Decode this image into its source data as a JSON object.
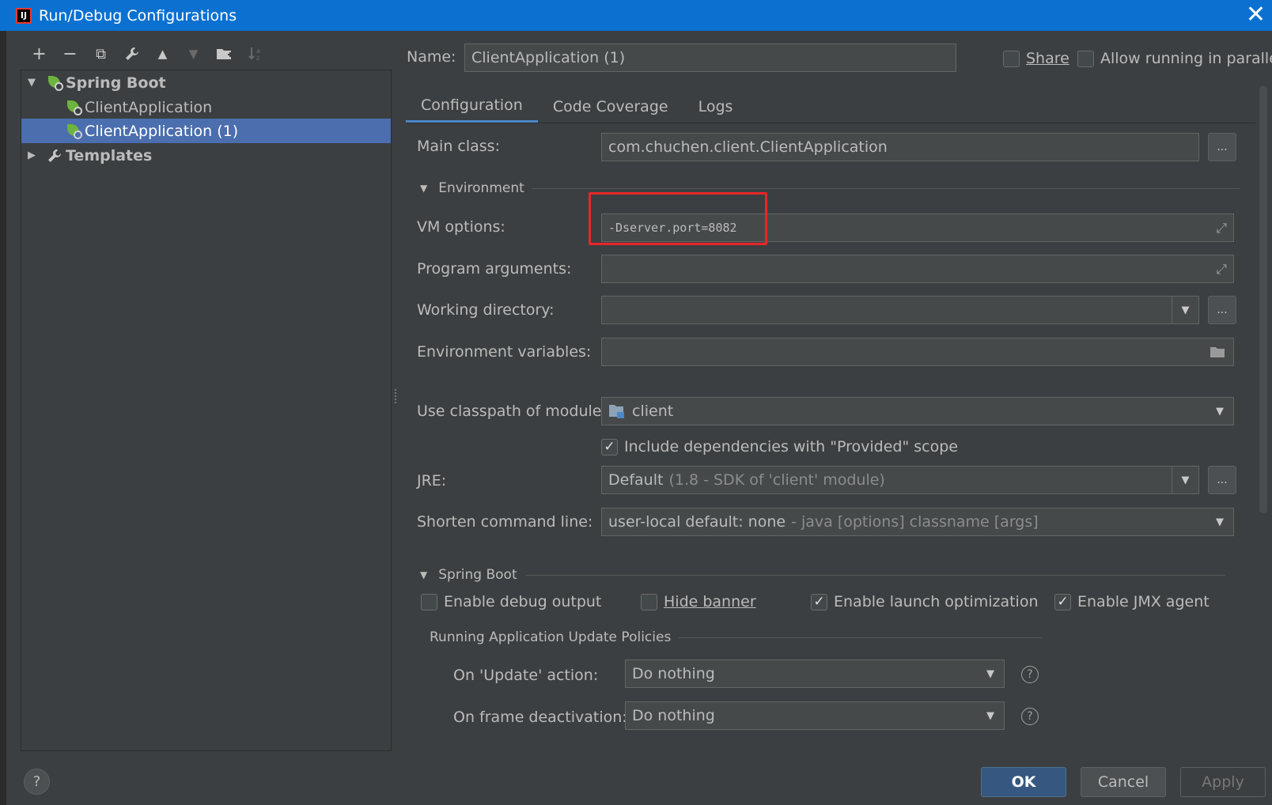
{
  "window": {
    "title": "Run/Debug Configurations",
    "app_icon": "IJ",
    "close_glyph": "✕"
  },
  "toolbar": {
    "add": "+",
    "remove": "−",
    "copy": "⧉",
    "wrench": "🔧",
    "up": "▲",
    "down": "▼",
    "folder": "▆",
    "sort": "↓"
  },
  "tree": {
    "groups": [
      {
        "label": "Spring Boot",
        "expanded": true,
        "items": [
          {
            "label": "ClientApplication"
          },
          {
            "label": "ClientApplication (1)",
            "selected": true
          }
        ]
      },
      {
        "label": "Templates",
        "expanded": false
      }
    ]
  },
  "header": {
    "name_label": "Name:",
    "name_value": "ClientApplication (1)",
    "share_label": "Share",
    "share_checked": false,
    "parallel_label": "Allow running in parallel",
    "parallel_checked": false
  },
  "tabs": [
    {
      "label": "Configuration",
      "active": true
    },
    {
      "label": "Code Coverage"
    },
    {
      "label": "Logs"
    }
  ],
  "config": {
    "main_class_label": "Main class:",
    "main_class_value": "com.chuchen.client.ClientApplication",
    "environment_section": "Environment",
    "vm_options_label": "VM options:",
    "vm_options_value": "-Dserver.port=8082",
    "program_args_label": "Program arguments:",
    "working_dir_label": "Working directory:",
    "env_vars_label": "Environment variables:",
    "classpath_label": "Use classpath of module:",
    "classpath_value": "client",
    "include_deps_label": "Include dependencies with \"Provided\" scope",
    "include_deps_checked": true,
    "jre_label": "JRE:",
    "jre_value": "Default",
    "jre_hint": "(1.8 - SDK of 'client' module)",
    "shorten_label": "Shorten command line:",
    "shorten_value": "user-local default: none",
    "shorten_hint": "- java [options] classname [args]",
    "dots": "..."
  },
  "spring_boot": {
    "section": "Spring Boot",
    "debug_output": {
      "label": "Enable debug output",
      "checked": false
    },
    "hide_banner": {
      "label": "Hide banner",
      "checked": false
    },
    "launch_opt": {
      "label": "Enable launch optimization",
      "checked": true
    },
    "jmx_agent": {
      "label": "Enable JMX agent",
      "checked": true
    },
    "policies_title": "Running Application Update Policies",
    "on_update_label": "On 'Update' action:",
    "on_update_value": "Do nothing",
    "on_frame_label": "On frame deactivation:",
    "on_frame_value": "Do nothing",
    "help_glyph": "?"
  },
  "buttons": {
    "ok": "OK",
    "cancel": "Cancel",
    "apply": "Apply",
    "help": "?"
  },
  "colors": {
    "accent": "#0a71d1",
    "selection": "#4b6eaf",
    "highlight_box": "#e8262a",
    "spring": "#6db33f"
  }
}
